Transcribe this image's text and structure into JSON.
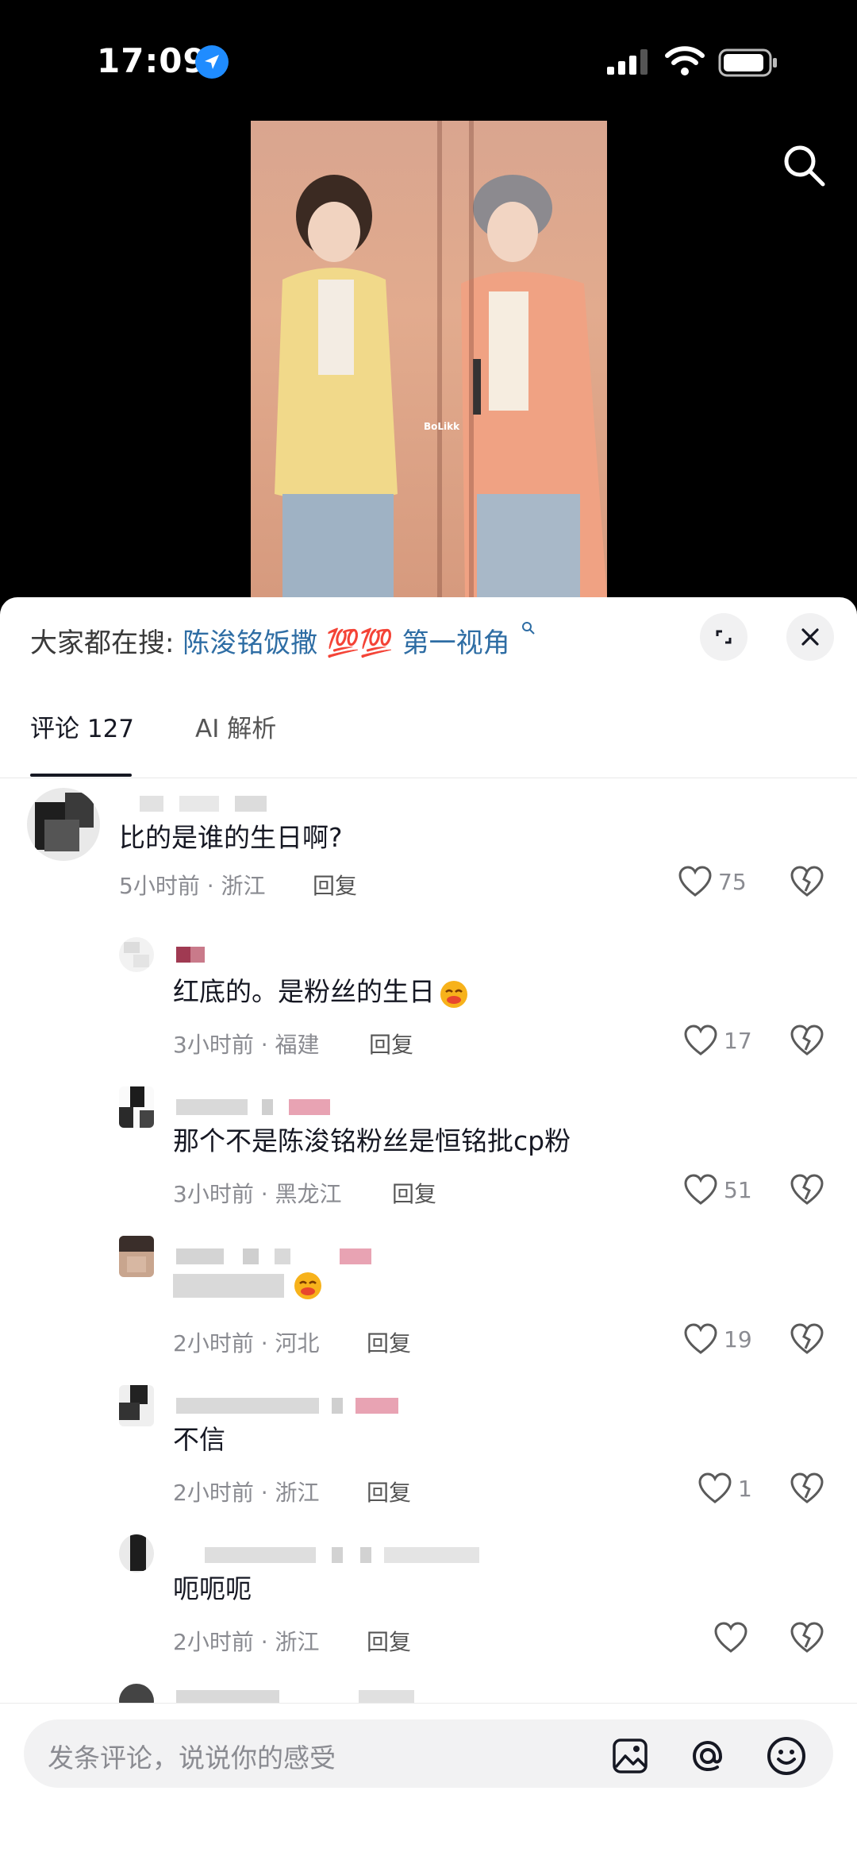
{
  "status_bar": {
    "time": "17:09"
  },
  "video": {
    "watermark": "BoLikk"
  },
  "search_suggestion": {
    "prefix": "大家都在搜:",
    "query": "陈浚铭饭撒 💯💯 第一视角"
  },
  "tabs": [
    {
      "label": "评论 127",
      "active": true
    },
    {
      "label": "AI 解析",
      "active": false
    }
  ],
  "comments": [
    {
      "text": "比的是谁的生日啊?",
      "time_location": "5小时前 · 浙江",
      "reply_label": "回复",
      "likes": "75"
    },
    {
      "text": "红底的。是粉丝的生日",
      "time_location": "3小时前 · 福建",
      "reply_label": "回复",
      "likes": "17"
    },
    {
      "text": "那个不是陈浚铭粉丝是恒铭批cp粉",
      "time_location": "3小时前 · 黑龙江",
      "reply_label": "回复",
      "likes": "51"
    },
    {
      "text": "",
      "time_location": "2小时前 · 河北",
      "reply_label": "回复",
      "likes": "19"
    },
    {
      "text": "不信",
      "time_location": "2小时前 · 浙江",
      "reply_label": "回复",
      "likes": "1"
    },
    {
      "text": "呃呃呃",
      "time_location": "2小时前 · 浙江",
      "reply_label": "回复",
      "likes": ""
    }
  ],
  "input": {
    "placeholder": "发条评论，说说你的感受"
  },
  "icons": [
    "location-arrow-icon",
    "signal-icon",
    "wifi-icon",
    "battery-icon",
    "search-icon",
    "expand-icon",
    "close-icon",
    "heart-icon",
    "broken-heart-icon",
    "image-icon",
    "at-icon",
    "emoji-icon"
  ],
  "colors": {
    "accent_link": "#2e6da4",
    "location_badge": "#1f8cff"
  }
}
